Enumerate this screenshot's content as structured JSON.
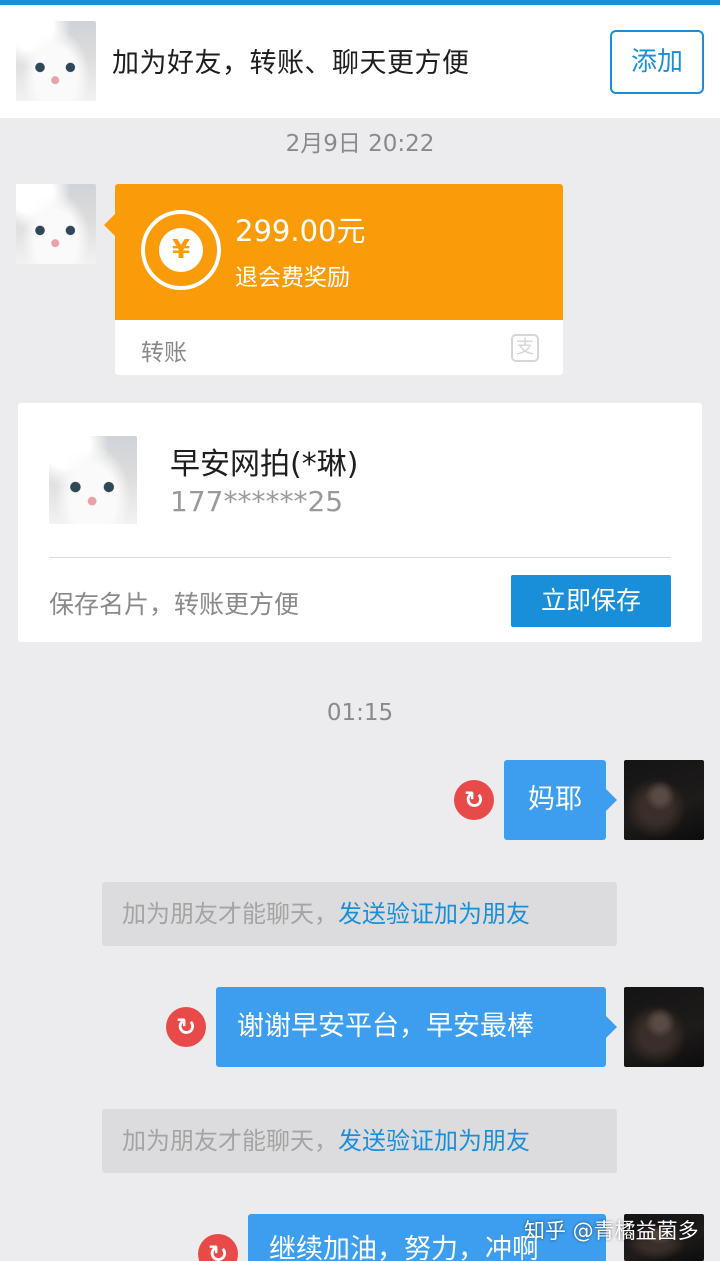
{
  "header": {
    "title": "加为好友，转账、聊天更方便",
    "add_button": "添加"
  },
  "timestamps": [
    "2月9日 20:22",
    "01:15"
  ],
  "transfer": {
    "amount": "299.00元",
    "note": "退会费奖励",
    "type_label": "转账",
    "coin_glyph": "¥",
    "alipay_glyph": "支"
  },
  "contact_card": {
    "name": "早安网拍(*琳)",
    "phone": "177******25",
    "hint": "保存名片，转账更方便",
    "save_button": "立即保存"
  },
  "messages": [
    {
      "text": "妈耶"
    },
    {
      "text": "谢谢早安平台，早安最棒"
    },
    {
      "text": "继续加油，努力，冲啊"
    }
  ],
  "notices": [
    {
      "text": "加为朋友才能聊天，",
      "link": "发送验证加为朋友"
    },
    {
      "text": "加为朋友才能聊天，",
      "link": "发送验证加为朋友"
    }
  ],
  "watermark": "知乎 @青橘益菌多",
  "colors": {
    "accent": "#1a8fd9",
    "transfer_orange": "#fa9b0a",
    "bubble_blue": "#3d9ef0",
    "error_red": "#e84a4a"
  },
  "icons": [
    "resend-icon",
    "coin-icon",
    "alipay-icon"
  ]
}
